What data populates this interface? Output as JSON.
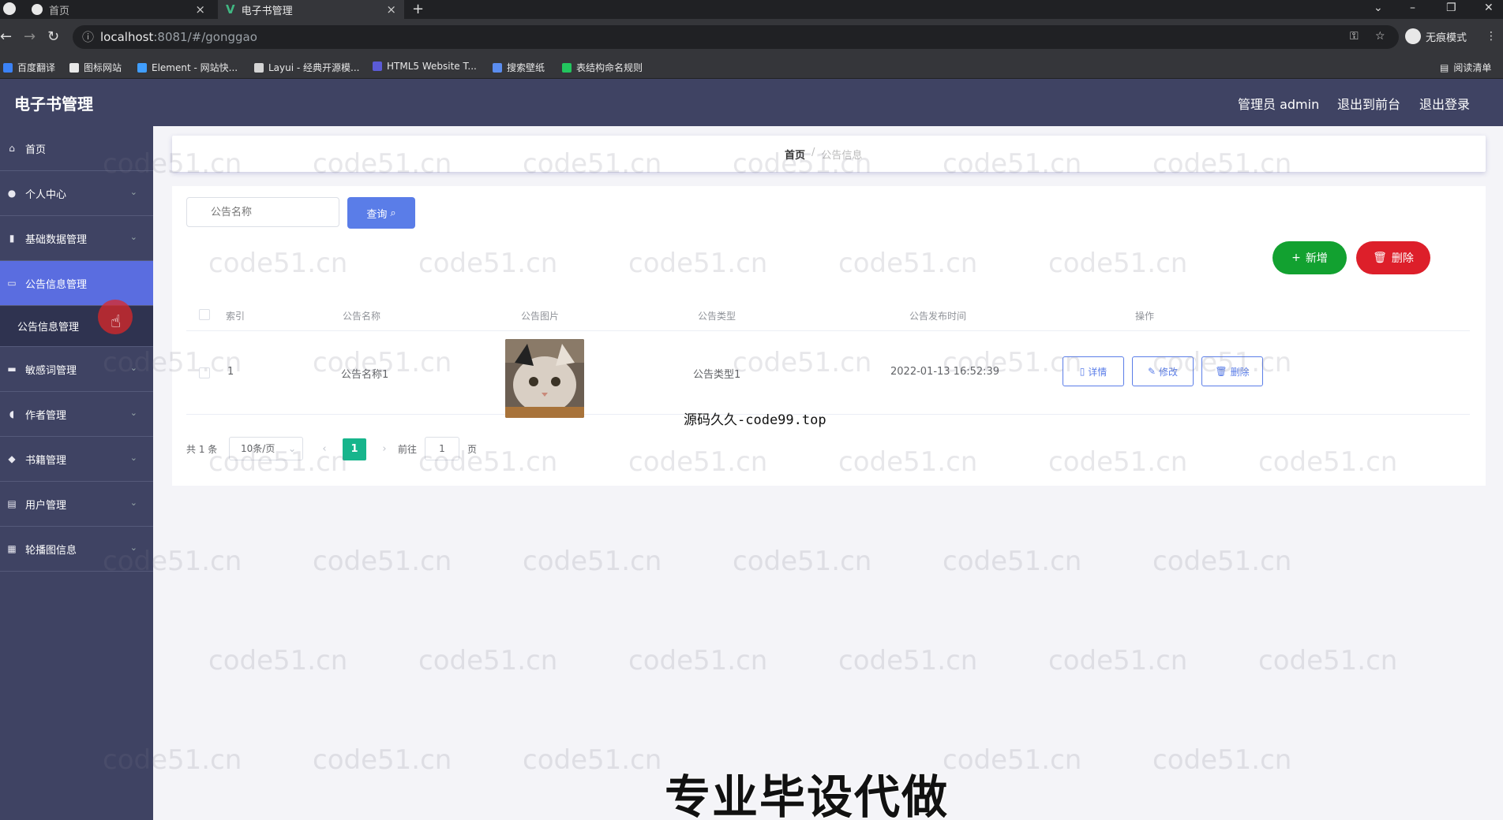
{
  "browser": {
    "tabs": [
      {
        "label": "首页",
        "active": false
      },
      {
        "label": "电子书管理",
        "active": true
      }
    ],
    "url_host": "localhost",
    "url_rest": ":8081/#/gonggao",
    "incognito_label": "无痕模式",
    "reading_list_label": "阅读清单",
    "bookmarks": [
      {
        "label": "百度翻译",
        "color": "#3b82f6"
      },
      {
        "label": "图标网站",
        "color": "#e8e8e8"
      },
      {
        "label": "Element - 网站快...",
        "color": "#409eff"
      },
      {
        "label": "Layui - 经典开源模...",
        "color": "#d4d4d4"
      },
      {
        "label": "HTML5 Website T...",
        "color": "#5b5bd6"
      },
      {
        "label": "搜索壁纸",
        "color": "#5b8def"
      },
      {
        "label": "表结构命名规则",
        "color": "#22c55e"
      }
    ]
  },
  "app": {
    "title": "电子书管理",
    "header_links": [
      "管理员 admin",
      "退出到前台",
      "退出登录"
    ],
    "menu": [
      {
        "label": "首页",
        "icon": "home-icon",
        "glyph": "⌂",
        "has_arrow": false
      },
      {
        "label": "个人中心",
        "icon": "user-icon",
        "glyph": "●",
        "has_arrow": true
      },
      {
        "label": "基础数据管理",
        "icon": "bar-chart-icon",
        "glyph": "▮",
        "has_arrow": true
      },
      {
        "label": "公告信息管理",
        "icon": "notice-icon",
        "glyph": "▭",
        "has_arrow": false,
        "active": true
      },
      {
        "label": "敏感词管理",
        "icon": "keyword-icon",
        "glyph": "▬",
        "has_arrow": true
      },
      {
        "label": "作者管理",
        "icon": "mic-icon",
        "glyph": "◖",
        "has_arrow": true
      },
      {
        "label": "书籍管理",
        "icon": "book-icon",
        "glyph": "◆",
        "has_arrow": true
      },
      {
        "label": "用户管理",
        "icon": "users-icon",
        "glyph": "▤",
        "has_arrow": true
      },
      {
        "label": "轮播图信息",
        "icon": "grid-icon",
        "glyph": "▦",
        "has_arrow": true
      }
    ],
    "submenu_label": "公告信息管理"
  },
  "breadcrumb": {
    "home": "首页",
    "separator": "/",
    "current": "公告信息"
  },
  "search": {
    "placeholder": "公告名称",
    "button_label": "查询"
  },
  "actions": {
    "add_label": "新增",
    "delete_label": "删除"
  },
  "table": {
    "columns": [
      "索引",
      "公告名称",
      "公告图片",
      "公告类型",
      "公告发布时间",
      "操作"
    ],
    "rows": [
      {
        "index": "1",
        "name": "公告名称1",
        "type": "公告类型1",
        "time": "2022-01-13 16:52:39"
      }
    ],
    "row_actions": [
      "详情",
      "修改",
      "删除"
    ]
  },
  "pagination": {
    "total_text": "共 1 条",
    "page_size": "10条/页",
    "current_page": "1",
    "goto_prefix": "前往",
    "goto_value": "1",
    "goto_suffix": "页"
  },
  "watermark": "code51.cn",
  "overlay_source_text": "源码久久-code99.top",
  "caption": "专业毕设代做"
}
